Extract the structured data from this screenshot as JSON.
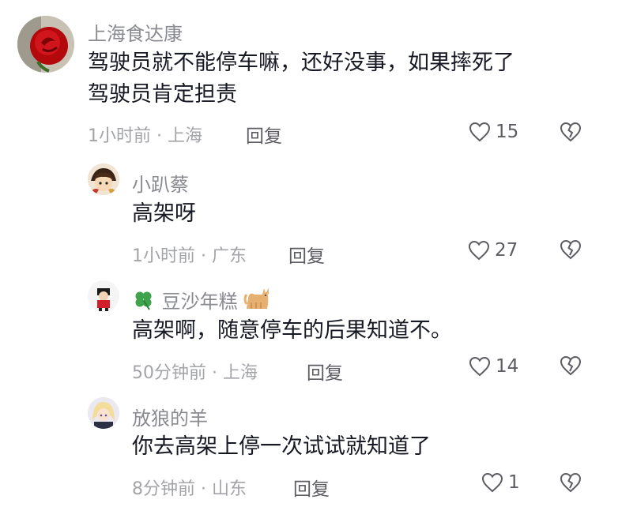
{
  "comments": [
    {
      "username": "上海食达康",
      "content_lines": [
        "驾驶员就不能停车嘛，还好没事，如果摔死了",
        "驾驶员肯定担责"
      ],
      "time": "1小时前 · 上海",
      "reply_label": "回复",
      "likes": "15",
      "avatar_icon": "red-rose-avatar"
    },
    {
      "username": "小趴蔡",
      "content_lines": [
        "高架呀"
      ],
      "time": "1小时前 · 广东",
      "reply_label": "回复",
      "likes": "27",
      "avatar_icon": "cartoon-avatar"
    },
    {
      "username": "豆沙年糕",
      "username_prefix_icon": "four-leaf-clover-icon",
      "username_suffix_icon": "cat-icon",
      "content_lines": [
        "高架啊，随意停车的后果知道不。"
      ],
      "time": "50分钟前 · 上海",
      "reply_label": "回复",
      "likes": "14",
      "avatar_icon": "cartoon-figure-avatar"
    },
    {
      "username": "放狼的羊",
      "content_lines": [
        "你去高架上停一次试试就知道了"
      ],
      "time": "8分钟前 · 山东",
      "reply_label": "回复",
      "likes": "1",
      "avatar_icon": "anime-character-avatar"
    }
  ],
  "colors": {
    "username": "#8a8b91",
    "content": "#161823",
    "meta": "#a3a4a8",
    "action": "#5c5d63"
  }
}
